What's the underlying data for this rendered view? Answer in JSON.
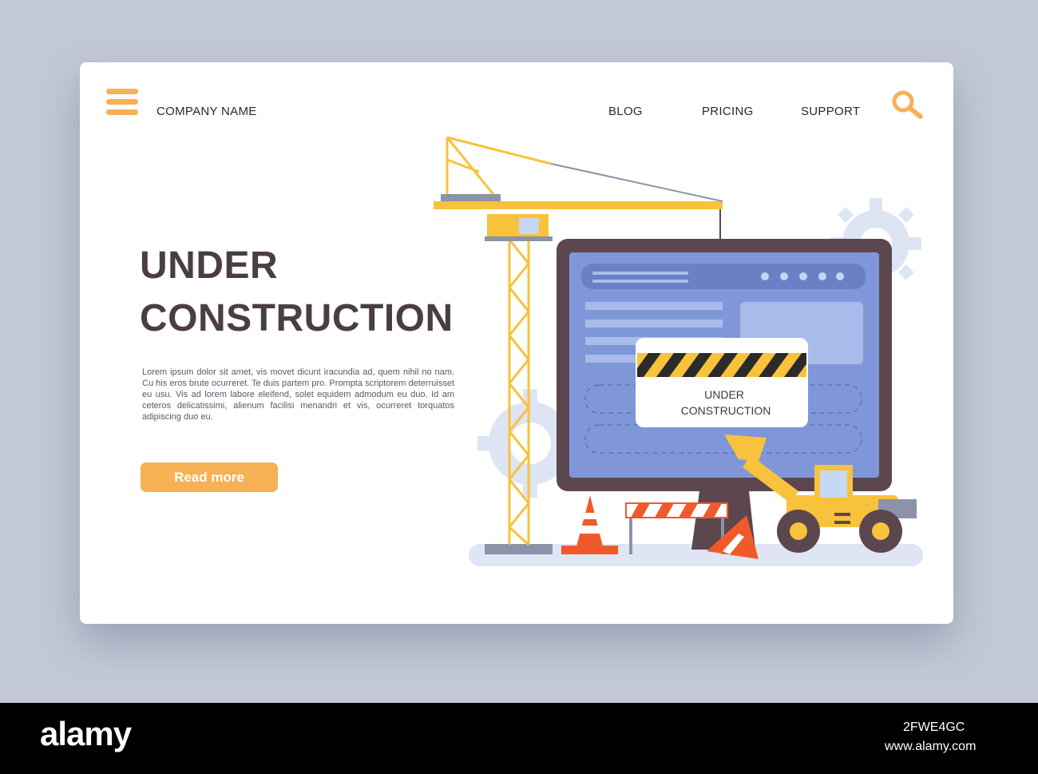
{
  "header": {
    "company": "COMPANY NAME",
    "nav": [
      "BLOG",
      "PRICING",
      "SUPPORT"
    ]
  },
  "icons": {
    "menu": "hamburger-menu-icon",
    "search": "search-icon"
  },
  "hero": {
    "title_line1": "UNDER",
    "title_line2": "CONSTRUCTION",
    "body": "Lorem ipsum dolor sit amet, vis movet dicunt iracundia ad, quem nihil no nam. Cu his eros brute ocurreret. Te duis partem pro. Prompta scriptorem deterruisset eu usu. Vis ad lorem labore eleifend, solet equidem admodum eu duo. Id am ceteros delicatissimi, alienum facilisi menandri et vis, ocurreret torquatos adipiscing duo eu.",
    "button": "Read more"
  },
  "illustration": {
    "sign_line1": "UNDER",
    "sign_line2": "CONSTRUCTION"
  },
  "footer": {
    "logo": "alamy",
    "image_id": "2FWE4GC",
    "url": "www.alamy.com"
  },
  "colors": {
    "accent": "#f7b155",
    "background": "#c3c8d7",
    "crane": "#f9c23c",
    "screen": "#7f97d9",
    "monitor": "#5c474f",
    "cone": "#f05a2a",
    "title": "#4a3d44"
  }
}
